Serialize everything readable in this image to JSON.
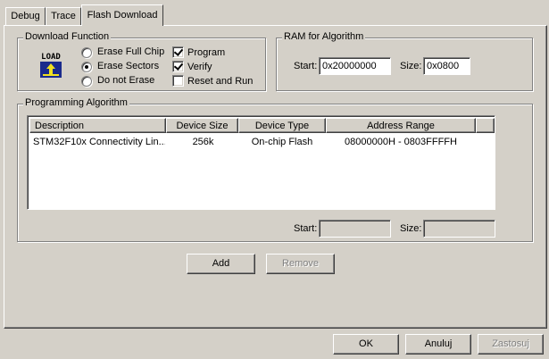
{
  "tabs": [
    {
      "label": "Debug"
    },
    {
      "label": "Trace"
    },
    {
      "label": "Flash Download"
    }
  ],
  "download_function": {
    "title": "Download Function",
    "icon_text": "LOAD",
    "radios": [
      {
        "label": "Erase Full Chip",
        "selected": false
      },
      {
        "label": "Erase Sectors",
        "selected": true
      },
      {
        "label": "Do not Erase",
        "selected": false
      }
    ],
    "checks": [
      {
        "label": "Program",
        "checked": true
      },
      {
        "label": "Verify",
        "checked": true
      },
      {
        "label": "Reset and Run",
        "checked": false
      }
    ]
  },
  "ram": {
    "title": "RAM for Algorithm",
    "start_label": "Start:",
    "start_value": "0x20000000",
    "size_label": "Size:",
    "size_value": "0x0800"
  },
  "programming": {
    "title": "Programming Algorithm",
    "columns": [
      "Description",
      "Device Size",
      "Device Type",
      "Address Range"
    ],
    "rows": [
      {
        "description": "STM32F10x Connectivity Lin...",
        "size": "256k",
        "type": "On-chip Flash",
        "range": "08000000H - 0803FFFFH"
      }
    ],
    "start_label": "Start:",
    "start_value": "",
    "size_label": "Size:",
    "size_value": ""
  },
  "buttons": {
    "add": "Add",
    "remove": "Remove",
    "ok": "OK",
    "cancel": "Anuluj",
    "apply": "Zastosuj"
  }
}
